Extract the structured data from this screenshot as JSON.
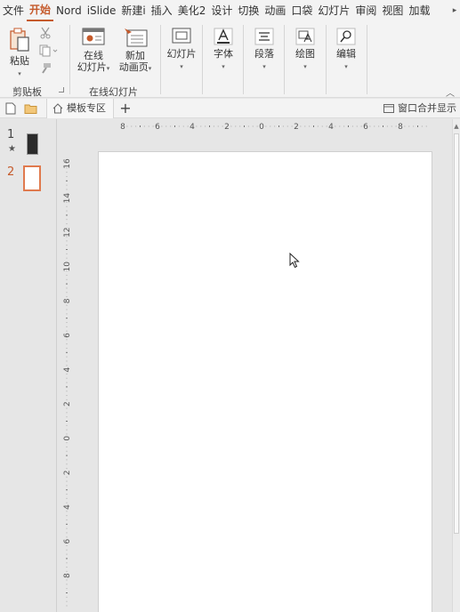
{
  "tabs": [
    "文件",
    "开始",
    "Nord",
    "iSlide",
    "新建i",
    "插入",
    "美化2",
    "设计",
    "切换",
    "动画",
    "口袋",
    "幻灯片",
    "审阅",
    "视图",
    "加载"
  ],
  "active_tab_index": 1,
  "ribbon": {
    "paste_label": "粘贴",
    "clipboard_group": "剪贴板",
    "online_slides_line1": "在线",
    "online_slides_line2": "幻灯片",
    "new_anim_line1": "新加",
    "new_anim_line2": "动画页",
    "online_group": "在线幻灯片",
    "slides_label": "幻灯片",
    "font_label": "字体",
    "paragraph_label": "段落",
    "drawing_label": "绘图",
    "editing_label": "编辑"
  },
  "docstrip": {
    "template_tab": "模板专区",
    "plus": "+",
    "window_merge": "窗口合并显示"
  },
  "slides": [
    {
      "number": "1",
      "mark": "★"
    },
    {
      "number": "2",
      "mark": ""
    }
  ],
  "ruler": {
    "h_labels": [
      "8",
      "6",
      "4",
      "2",
      "0",
      "2",
      "4",
      "6",
      "8"
    ],
    "v_labels": [
      "16",
      "14",
      "12",
      "10",
      "8",
      "6",
      "4",
      "2",
      "0",
      "2",
      "4",
      "6",
      "8"
    ]
  },
  "colors": {
    "accent": "#c55a2b",
    "ribbon_bg": "#f3f3f3",
    "workspace_bg": "#e6e6e6"
  }
}
